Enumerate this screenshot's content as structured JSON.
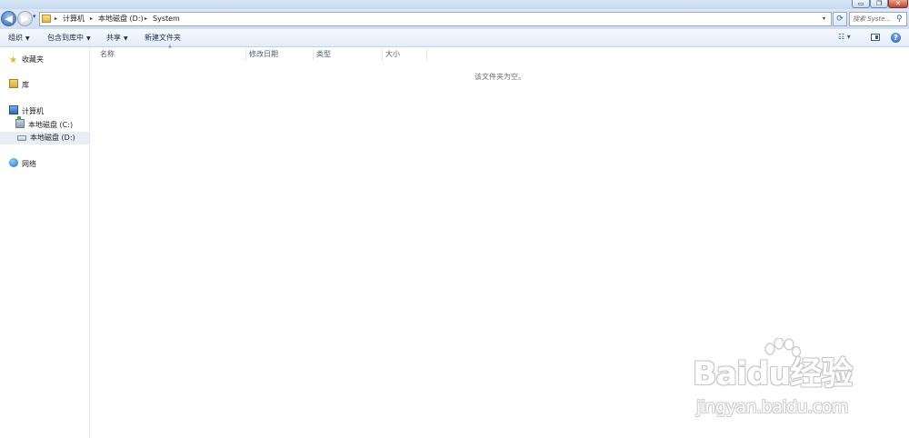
{
  "window": {
    "minimize_glyph": "▭",
    "maximize_glyph": "❐",
    "close_glyph": "✕"
  },
  "address": {
    "back_icon": "◀",
    "forward_icon": "▶",
    "recent_dropdown": "▾",
    "crumbs": [
      "计算机",
      "本地磁盘 (D:)",
      "System"
    ],
    "separator": "▸",
    "dropdown": "▾",
    "refresh_icon": "⟳",
    "search_placeholder": "搜索 Syste...",
    "search_icon": "⚲"
  },
  "toolbar": {
    "organize": "组织",
    "include_in_library": "包含到库中",
    "share": "共享",
    "new_folder": "新建文件夹",
    "dropdown_arrow": "▼",
    "view_icon": "☷ ▾",
    "help_icon": "?"
  },
  "nav": {
    "favorites": "收藏夹",
    "libraries": "库",
    "computer": "计算机",
    "drive_c": "本地磁盘 (C:)",
    "drive_d": "本地磁盘 (D:)",
    "network": "网络",
    "favorites_icon": "★"
  },
  "columns": {
    "name": "名称",
    "date_modified": "修改日期",
    "type": "类型",
    "size": "大小",
    "sort_indicator": "▲"
  },
  "content": {
    "empty_message": "该文件夹为空。"
  },
  "watermark": {
    "logo_text": "Baidu经验",
    "url": "jingyan.baidu.com"
  }
}
